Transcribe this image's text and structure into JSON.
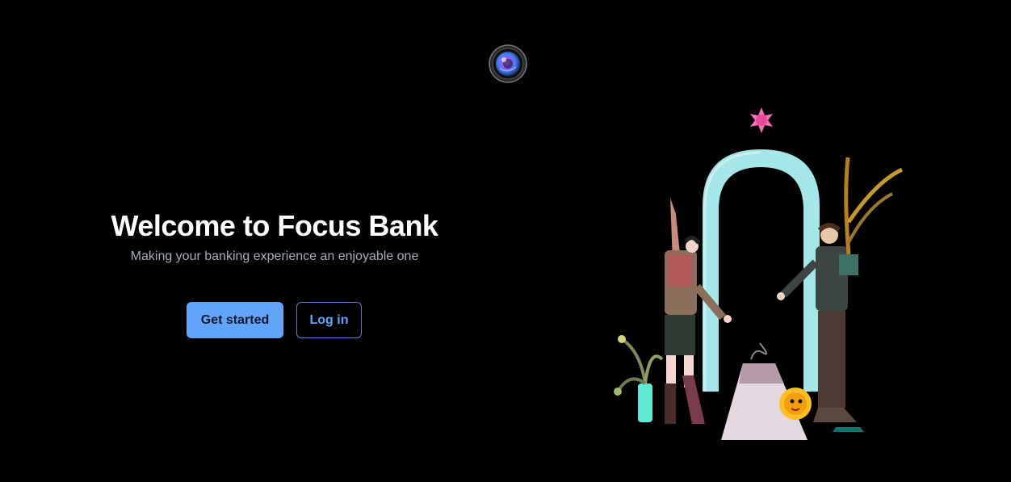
{
  "header": {
    "logo_icon": "camera-lens-logo"
  },
  "hero": {
    "title": "Welcome to Focus Bank",
    "subtitle": "Making your banking experience an enjoyable one"
  },
  "actions": {
    "get_started_label": "Get started",
    "login_label": "Log in"
  },
  "illustration": {
    "icon": "welcome-arch-illustration"
  },
  "colors": {
    "background": "#000000",
    "accent": "#60a5fa",
    "title": "#ffffff",
    "subtitle": "#a7adb8"
  }
}
